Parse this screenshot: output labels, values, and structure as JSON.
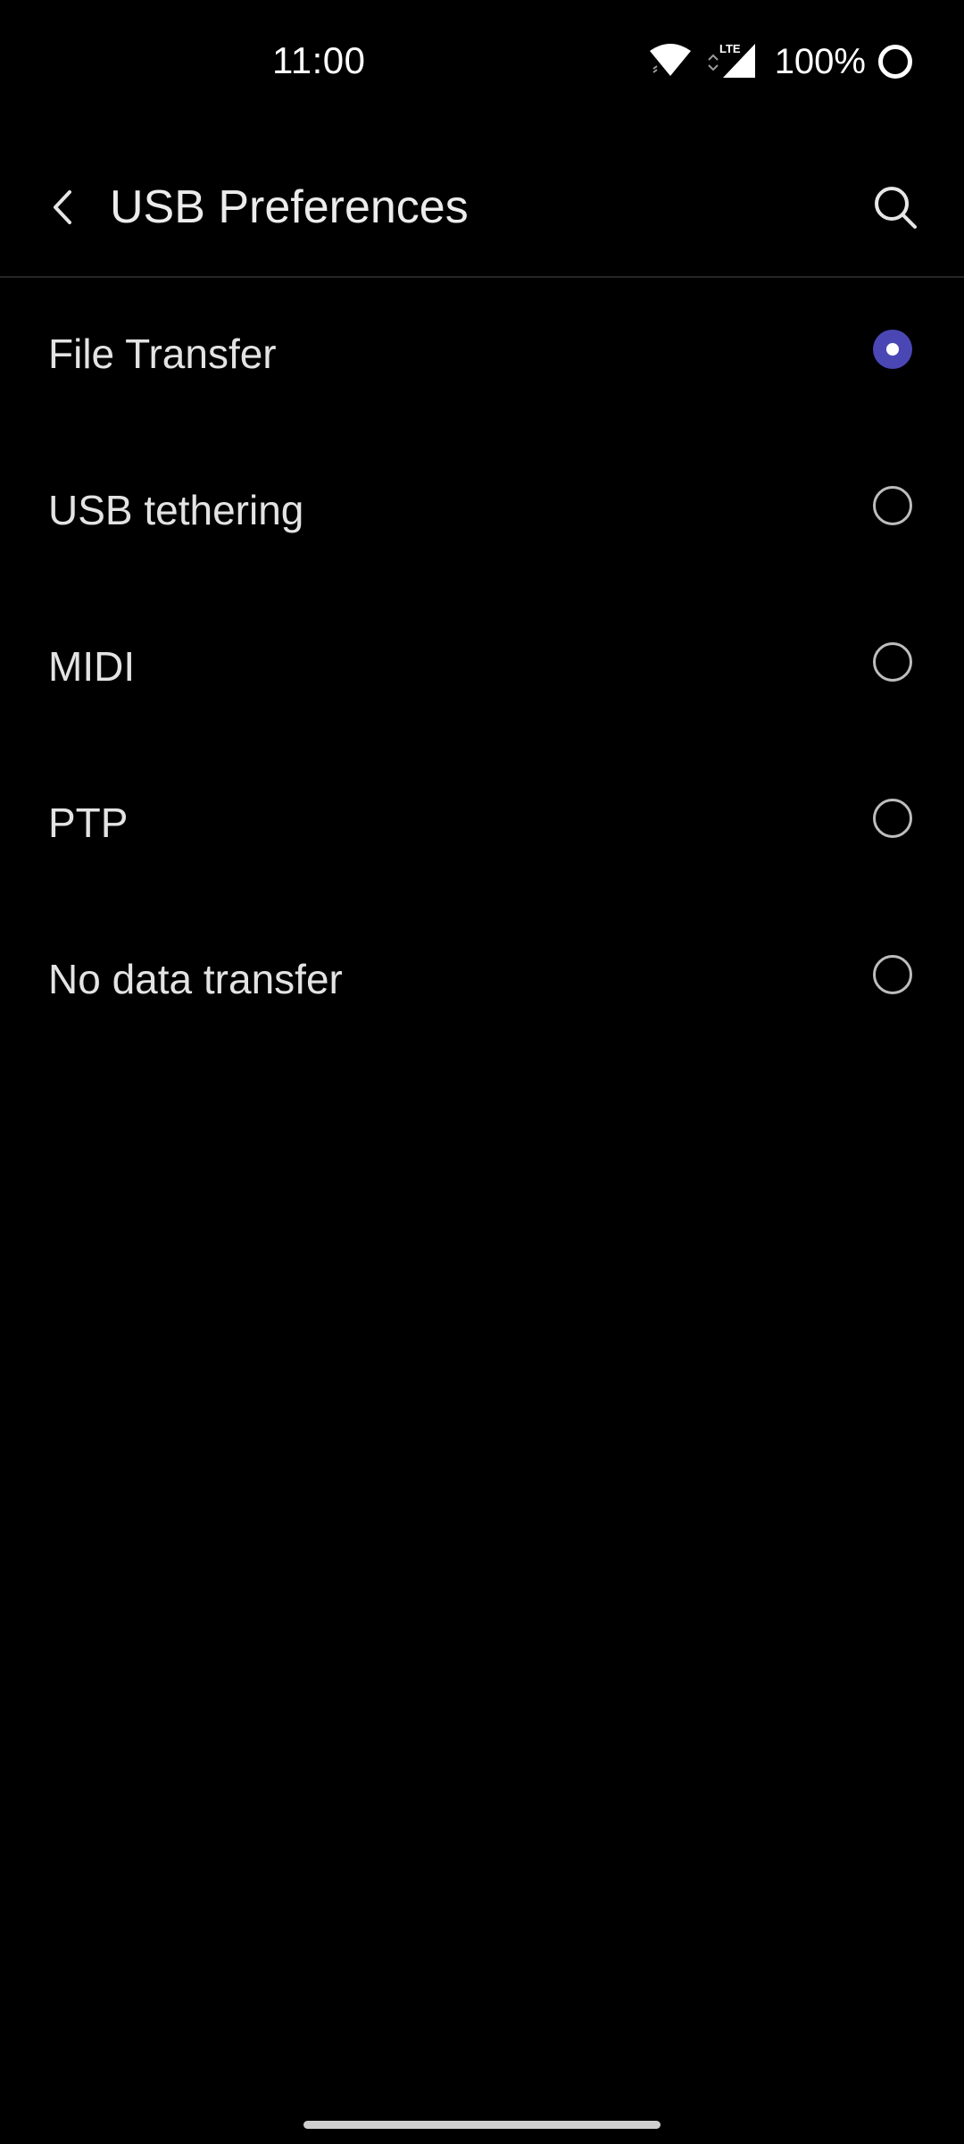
{
  "status_bar": {
    "time": "11:00",
    "network_label": "LTE",
    "battery_percent": "100%",
    "icons": [
      "wifi-icon",
      "lte-signal-icon",
      "battery-ring-icon"
    ]
  },
  "app_bar": {
    "title": "USB Preferences",
    "back_icon": "chevron-left-icon",
    "search_icon": "search-icon"
  },
  "options": [
    {
      "label": "File Transfer",
      "selected": true
    },
    {
      "label": "USB tethering",
      "selected": false
    },
    {
      "label": "MIDI",
      "selected": false
    },
    {
      "label": "PTP",
      "selected": false
    },
    {
      "label": "No data transfer",
      "selected": false
    }
  ],
  "colors": {
    "background": "#000000",
    "accent_radio": "#4a47b5",
    "text": "#e3e3e3"
  }
}
